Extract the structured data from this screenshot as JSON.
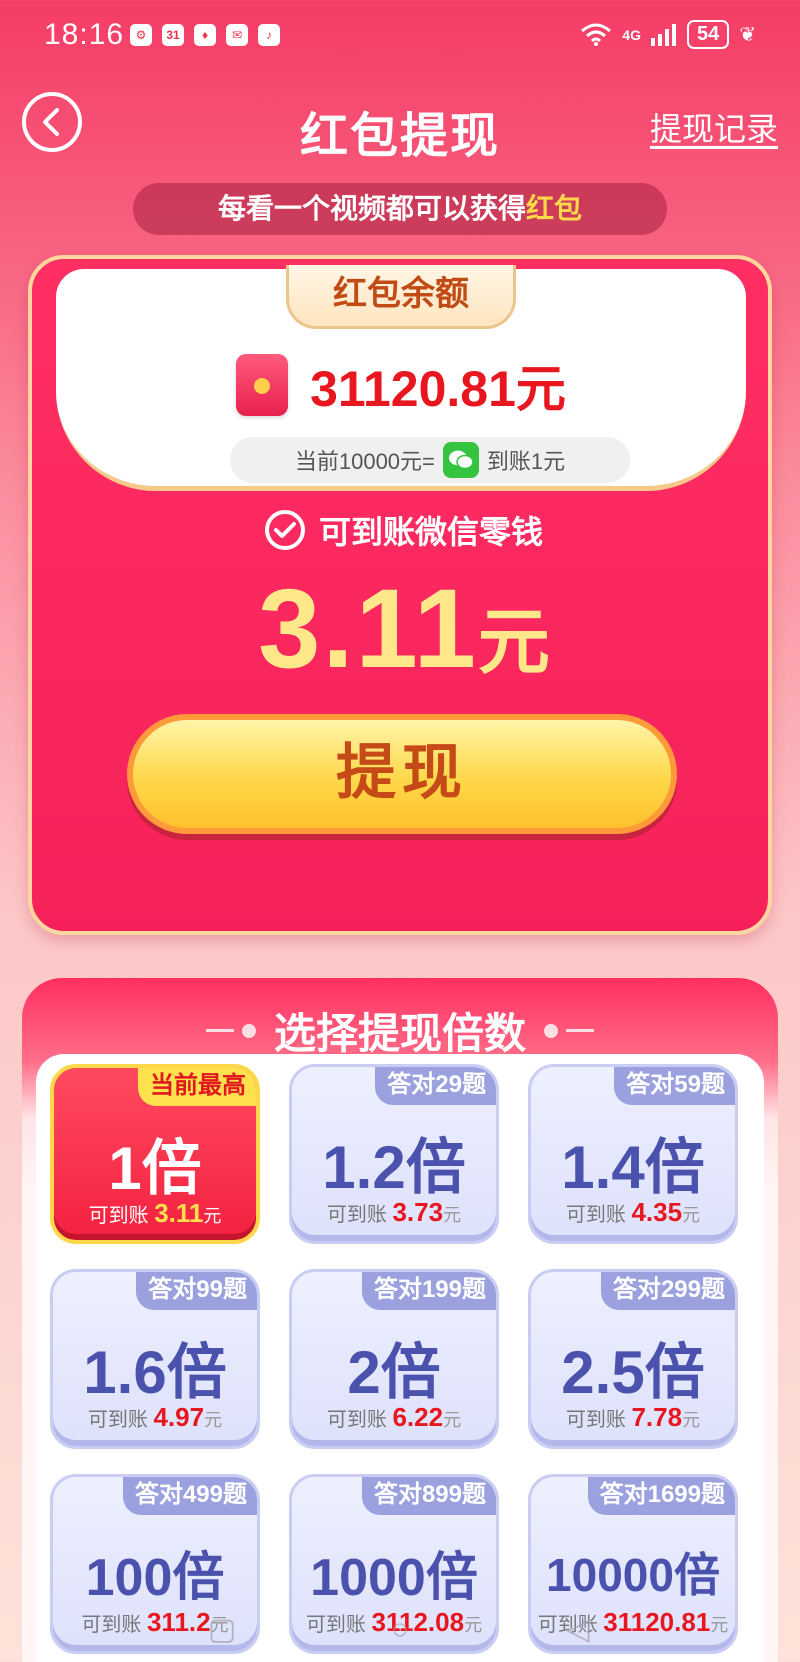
{
  "status_bar": {
    "time": "18:16",
    "app_icons": [
      "settings-icon",
      "calendar-icon",
      "game-icon",
      "gift-icon",
      "music-icon"
    ],
    "calendar_label": "31",
    "network": "4G",
    "battery": "54"
  },
  "header": {
    "title": "红包提现",
    "history_link": "提现记录"
  },
  "promo": {
    "text": "每看一个视频都可以获得",
    "highlight": "红包"
  },
  "balance": {
    "label": "红包余额",
    "amount": "31120.81元",
    "rate_left": "当前10000元=",
    "rate_right": "到账1元"
  },
  "withdraw": {
    "check_text": "可到账微信零钱",
    "amount_number": "3.11",
    "amount_unit": "元",
    "button_label": "提现"
  },
  "multiplier": {
    "title": "选择提现倍数",
    "arrival_label": "可到账",
    "unit": "元",
    "options": [
      {
        "badge": "当前最高",
        "multiplier": "1倍",
        "value": "3.11",
        "selected": true
      },
      {
        "badge": "答对29题",
        "multiplier": "1.2倍",
        "value": "3.73",
        "selected": false
      },
      {
        "badge": "答对59题",
        "multiplier": "1.4倍",
        "value": "4.35",
        "selected": false
      },
      {
        "badge": "答对99题",
        "multiplier": "1.6倍",
        "value": "4.97",
        "selected": false
      },
      {
        "badge": "答对199题",
        "multiplier": "2倍",
        "value": "6.22",
        "selected": false
      },
      {
        "badge": "答对299题",
        "multiplier": "2.5倍",
        "value": "7.78",
        "selected": false
      },
      {
        "badge": "答对499题",
        "multiplier": "100倍",
        "value": "311.2",
        "selected": false
      },
      {
        "badge": "答对899题",
        "multiplier": "1000倍",
        "value": "3112.08",
        "selected": false
      },
      {
        "badge": "答对1699题",
        "multiplier": "10000倍",
        "value": "31120.81",
        "selected": false
      }
    ]
  },
  "colors": {
    "accent_red": "#f6215a",
    "gold": "#ffd84a",
    "value_red": "#e8171f",
    "option_blue": "#4a52ad"
  }
}
